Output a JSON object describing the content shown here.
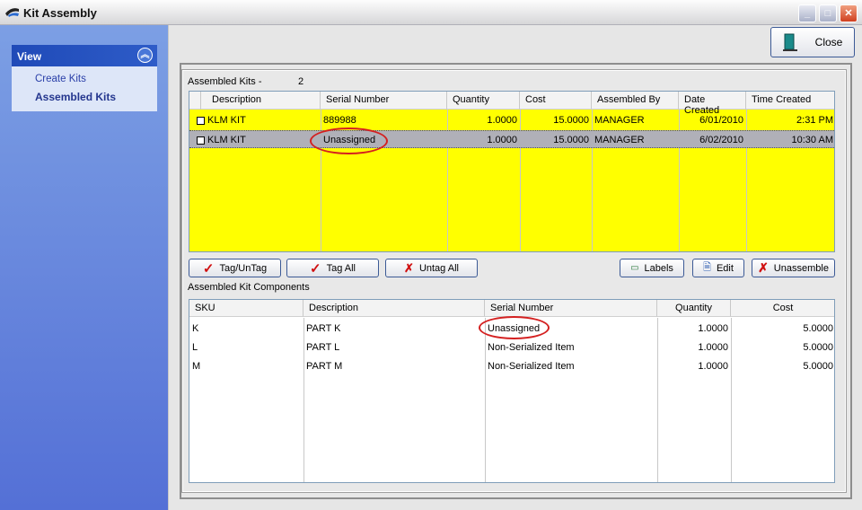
{
  "window": {
    "title": "Kit Assembly",
    "controls": [
      "minimize",
      "maximize",
      "close"
    ]
  },
  "sidebar": {
    "panel_title": "View",
    "items": [
      {
        "label": "Create Kits",
        "active": false
      },
      {
        "label": "Assembled Kits",
        "active": true
      }
    ]
  },
  "toolbar": {
    "close_label": "Close"
  },
  "assembled_kits": {
    "label": "Assembled Kits -",
    "count": "2",
    "columns": [
      "Description",
      "Serial Number",
      "Quantity",
      "Cost",
      "Assembled By",
      "Date Created",
      "Time Created"
    ],
    "rows": [
      {
        "description": "KLM KIT",
        "serial": "889988",
        "quantity": "1.0000",
        "cost": "15.0000",
        "assembled_by": "MANAGER",
        "date": "6/01/2010",
        "time": "2:31 PM",
        "selected": false
      },
      {
        "description": "KLM KIT",
        "serial": "Unassigned",
        "quantity": "1.0000",
        "cost": "15.0000",
        "assembled_by": "MANAGER",
        "date": "6/02/2010",
        "time": "10:30 AM",
        "selected": true
      }
    ],
    "row_color": "#ffff00",
    "selected_color": "#b0b0b8"
  },
  "buttons": {
    "tag_untag": "Tag/UnTag",
    "tag_all": "Tag All",
    "untag_all": "Untag All",
    "labels": "Labels",
    "edit": "Edit",
    "unassemble": "Unassemble"
  },
  "components": {
    "label": "Assembled Kit Components",
    "columns": [
      "SKU",
      "Description",
      "Serial Number",
      "Quantity",
      "Cost"
    ],
    "rows": [
      {
        "sku": "K",
        "description": "PART K",
        "serial": "Unassigned",
        "quantity": "1.0000",
        "cost": "5.0000"
      },
      {
        "sku": "L",
        "description": "PART L",
        "serial": "Non-Serialized Item",
        "quantity": "1.0000",
        "cost": "5.0000"
      },
      {
        "sku": "M",
        "description": "PART M",
        "serial": "Non-Serialized Item",
        "quantity": "1.0000",
        "cost": "5.0000"
      }
    ]
  },
  "annotation_color": "#d42020"
}
